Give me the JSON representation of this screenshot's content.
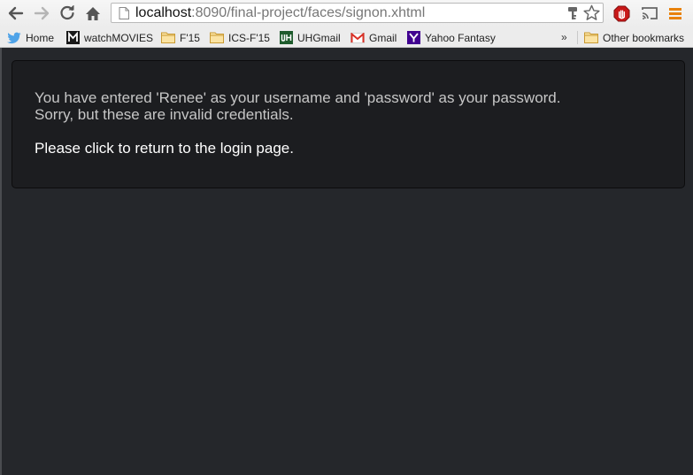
{
  "browser": {
    "url_host": "localhost",
    "url_rest": ":8090/final-project/faces/signon.xhtml"
  },
  "bookmarks": [
    {
      "label": "Home",
      "icon": "twitter-icon"
    },
    {
      "label": "watchMOVIES",
      "icon": "m-logo-icon"
    },
    {
      "label": "F'15",
      "icon": "folder-icon"
    },
    {
      "label": "ICS-F'15",
      "icon": "folder-icon"
    },
    {
      "label": "UHGmail",
      "icon": "uh-logo-icon"
    },
    {
      "label": "Gmail",
      "icon": "gmail-icon"
    },
    {
      "label": "Yahoo Fantasy",
      "icon": "yahoo-icon"
    }
  ],
  "bookmarks_more": "»",
  "other_bookmarks": "Other bookmarks",
  "page": {
    "message_line1": "You have entered 'Renee' as your username and 'password' as your password.",
    "message_line2": "Sorry, but these are invalid credentials.",
    "return_link": "Please click to return to the login page."
  },
  "colors": {
    "page_background": "#25272b",
    "panel_background": "#1c1d20",
    "message_text": "#c6c6c6",
    "link_text": "#ffffff"
  }
}
